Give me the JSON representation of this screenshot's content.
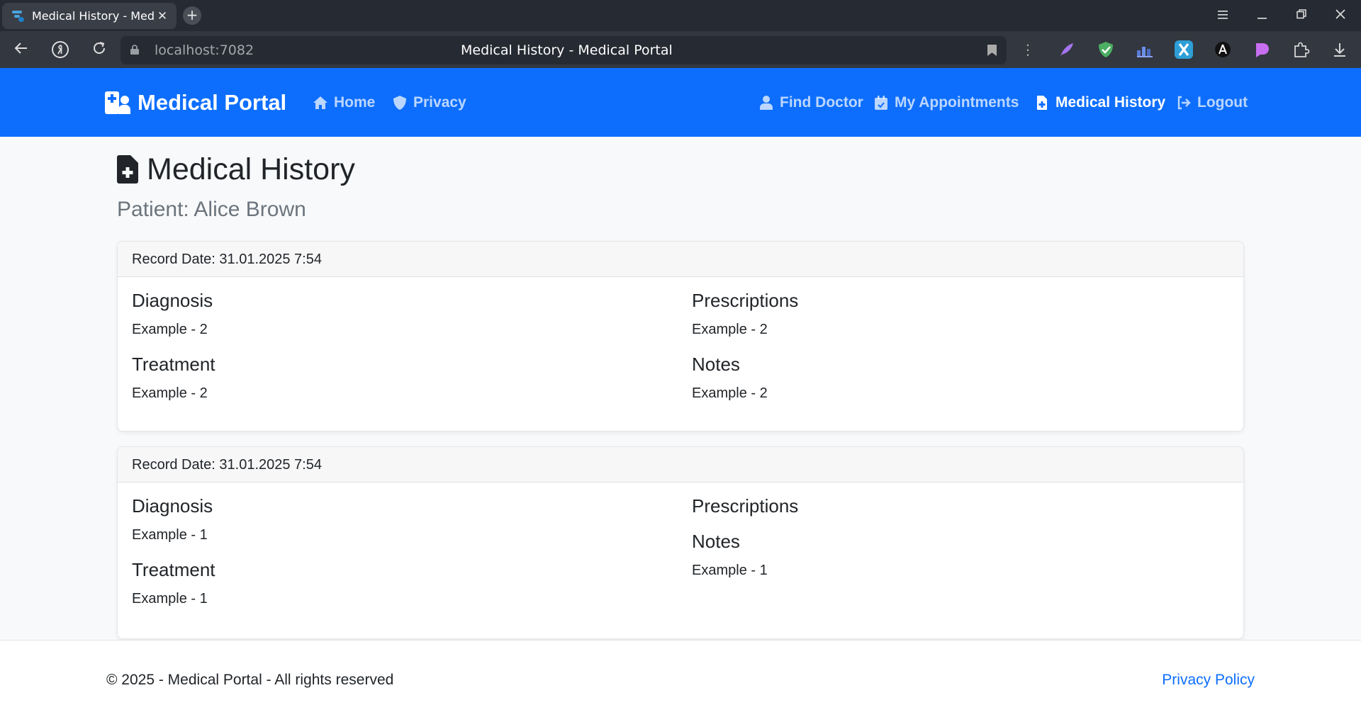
{
  "browser": {
    "tab_title": "Medical History - Medic",
    "tab_close": "✕",
    "new_tab": "+",
    "url": "localhost:7082",
    "page_title": "Medical History - Medical Portal",
    "more": "⋮"
  },
  "navbar": {
    "brand": "Medical Portal",
    "links": [
      {
        "label": "Home",
        "icon": "home-icon"
      },
      {
        "label": "Privacy",
        "icon": "shield-icon"
      },
      {
        "label": "Find Doctor",
        "icon": "user-doctor-icon"
      },
      {
        "label": "My Appointments",
        "icon": "calendar-check-icon"
      },
      {
        "label": "Medical History",
        "icon": "file-medical-icon",
        "active": true
      },
      {
        "label": "Logout",
        "icon": "logout-icon"
      }
    ],
    "bg_color": "#0d6efd"
  },
  "page": {
    "title": "Medical History",
    "patient": "Patient: Alice Brown"
  },
  "records": [
    {
      "date": "Record Date: 31.01.2025 7:54",
      "diagnosis_label": "Diagnosis",
      "diagnosis": "Example - 2",
      "treatment_label": "Treatment",
      "treatment": "Example - 2",
      "prescriptions_label": "Prescriptions",
      "prescriptions": "Example - 2",
      "notes_label": "Notes",
      "notes": "Example - 2"
    },
    {
      "date": "Record Date: 31.01.2025 7:54",
      "diagnosis_label": "Diagnosis",
      "diagnosis": "Example - 1",
      "treatment_label": "Treatment",
      "treatment": "Example - 1",
      "prescriptions_label": "Prescriptions",
      "prescriptions": "",
      "notes_label": "Notes",
      "notes": "Example - 1"
    }
  ],
  "footer": {
    "copyright": "© 2025 - Medical Portal - All rights reserved",
    "privacy_link": "Privacy Policy"
  }
}
